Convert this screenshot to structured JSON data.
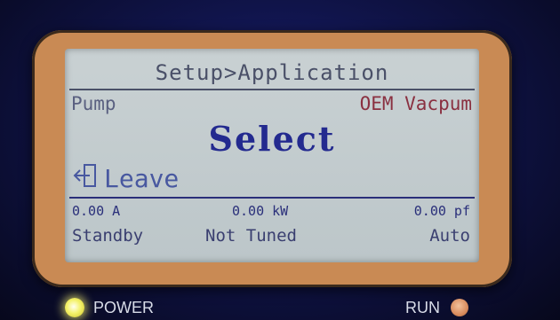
{
  "screen": {
    "title": "Setup>Application",
    "label_left": "Pump",
    "label_right": "OEM Vacpum",
    "selection": "Select",
    "leave_label": "Leave",
    "leave_icon": "leave-icon"
  },
  "status": {
    "current": "0.00 A",
    "power": "0.00 kW",
    "power_factor": "0.00 pf",
    "state": "Standby",
    "tuning": "Not Tuned",
    "mode": "Auto"
  },
  "indicators": {
    "power_label": "POWER",
    "run_label": "RUN"
  },
  "colors": {
    "lcd_background": "#c9d1d3",
    "lcd_text": "#24298a",
    "bezel": "#c98a54",
    "power_led": "#f4f26a",
    "run_led": "#d98c5e"
  }
}
